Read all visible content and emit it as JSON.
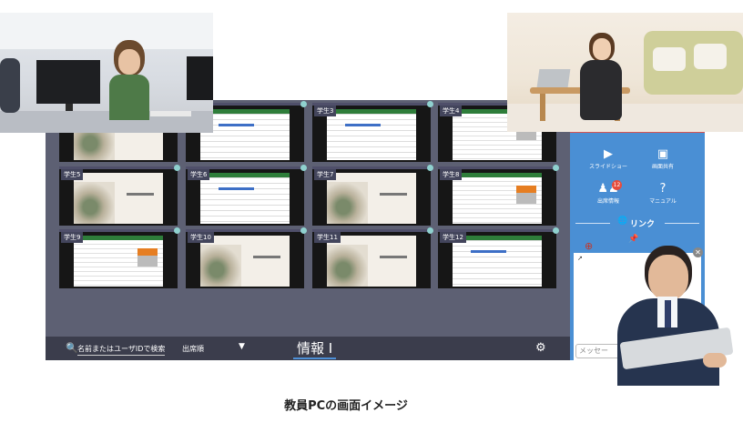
{
  "students": [
    {
      "label": "",
      "kind": "slide"
    },
    {
      "label": "",
      "kind": "sheet"
    },
    {
      "label": "学生3",
      "kind": "sheet"
    },
    {
      "label": "学生4",
      "kind": "table"
    },
    {
      "label": "学生5",
      "kind": "slide"
    },
    {
      "label": "学生6",
      "kind": "sheet"
    },
    {
      "label": "学生7",
      "kind": "slide"
    },
    {
      "label": "学生8",
      "kind": "table"
    },
    {
      "label": "学生9",
      "kind": "table"
    },
    {
      "label": "学生10",
      "kind": "slide"
    },
    {
      "label": "学生11",
      "kind": "slide"
    },
    {
      "label": "学生12",
      "kind": "sheet"
    }
  ],
  "bottombar": {
    "search_placeholder": "名前またはユーザIDで検索",
    "sort_label": "出席順",
    "class_title": "情報 I"
  },
  "panel": {
    "slideshow_label": "スライドショー",
    "screen_share_label": "画面共有",
    "attendance_label": "出席情報",
    "attendance_badge": "12",
    "manual_label": "マニュアル",
    "link_label": "リンク",
    "chat_placeholder": "メッセー"
  },
  "caption": "教員PCの画面イメージ"
}
